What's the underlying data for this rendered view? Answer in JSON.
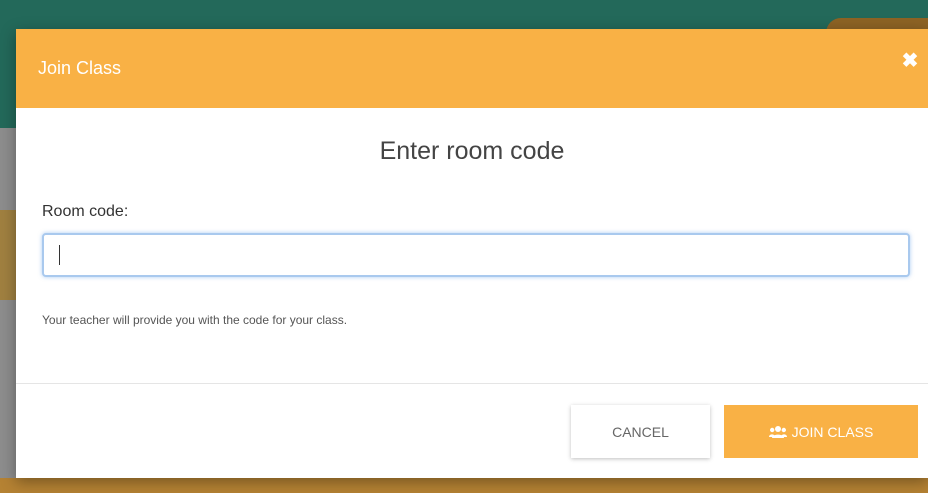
{
  "dialog": {
    "title": "Join Class",
    "close_icon": "close-icon",
    "heading": "Enter room code",
    "field": {
      "label": "Room code:",
      "value": "",
      "placeholder": ""
    },
    "help_text": "Your teacher will provide you with the code for your class.",
    "buttons": {
      "cancel_label": "CANCEL",
      "join_label": "JOIN CLASS",
      "join_icon": "users-icon"
    }
  },
  "colors": {
    "accent": "#f9b145",
    "background_teal": "#23695a",
    "input_focus_border": "#a9c9ee"
  }
}
